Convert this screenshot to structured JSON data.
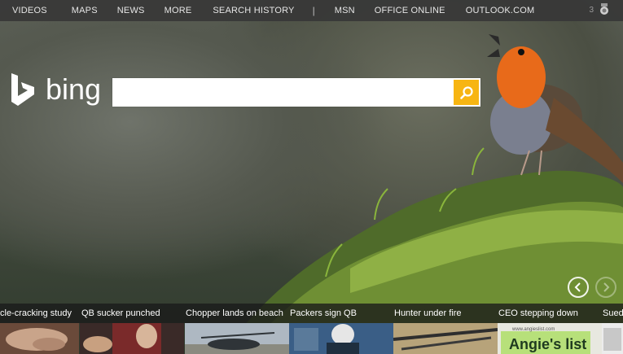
{
  "topnav": {
    "items": [
      "VIDEOS",
      "MAPS",
      "NEWS",
      "MORE",
      "SEARCH HISTORY",
      "MSN",
      "OFFICE ONLINE",
      "OUTLOOK.COM"
    ],
    "separator": "|",
    "rewards_count": "3"
  },
  "logo": {
    "text": "bing"
  },
  "search": {
    "value": "",
    "placeholder": ""
  },
  "carousel": {
    "prev_label": "‹",
    "next_label": "›"
  },
  "news": [
    {
      "caption": "cle-cracking study"
    },
    {
      "caption": "QB sucker punched"
    },
    {
      "caption": "Chopper lands on beach"
    },
    {
      "caption": "Packers sign QB"
    },
    {
      "caption": "Hunter under fire"
    },
    {
      "caption": "CEO stepping down"
    },
    {
      "caption": "Sued"
    }
  ],
  "thumb_texts": {
    "angies": "Angie's list",
    "angies_url": "www.angieslist.com"
  },
  "colors": {
    "accent": "#f7b512",
    "nav_bg": "#373737"
  }
}
